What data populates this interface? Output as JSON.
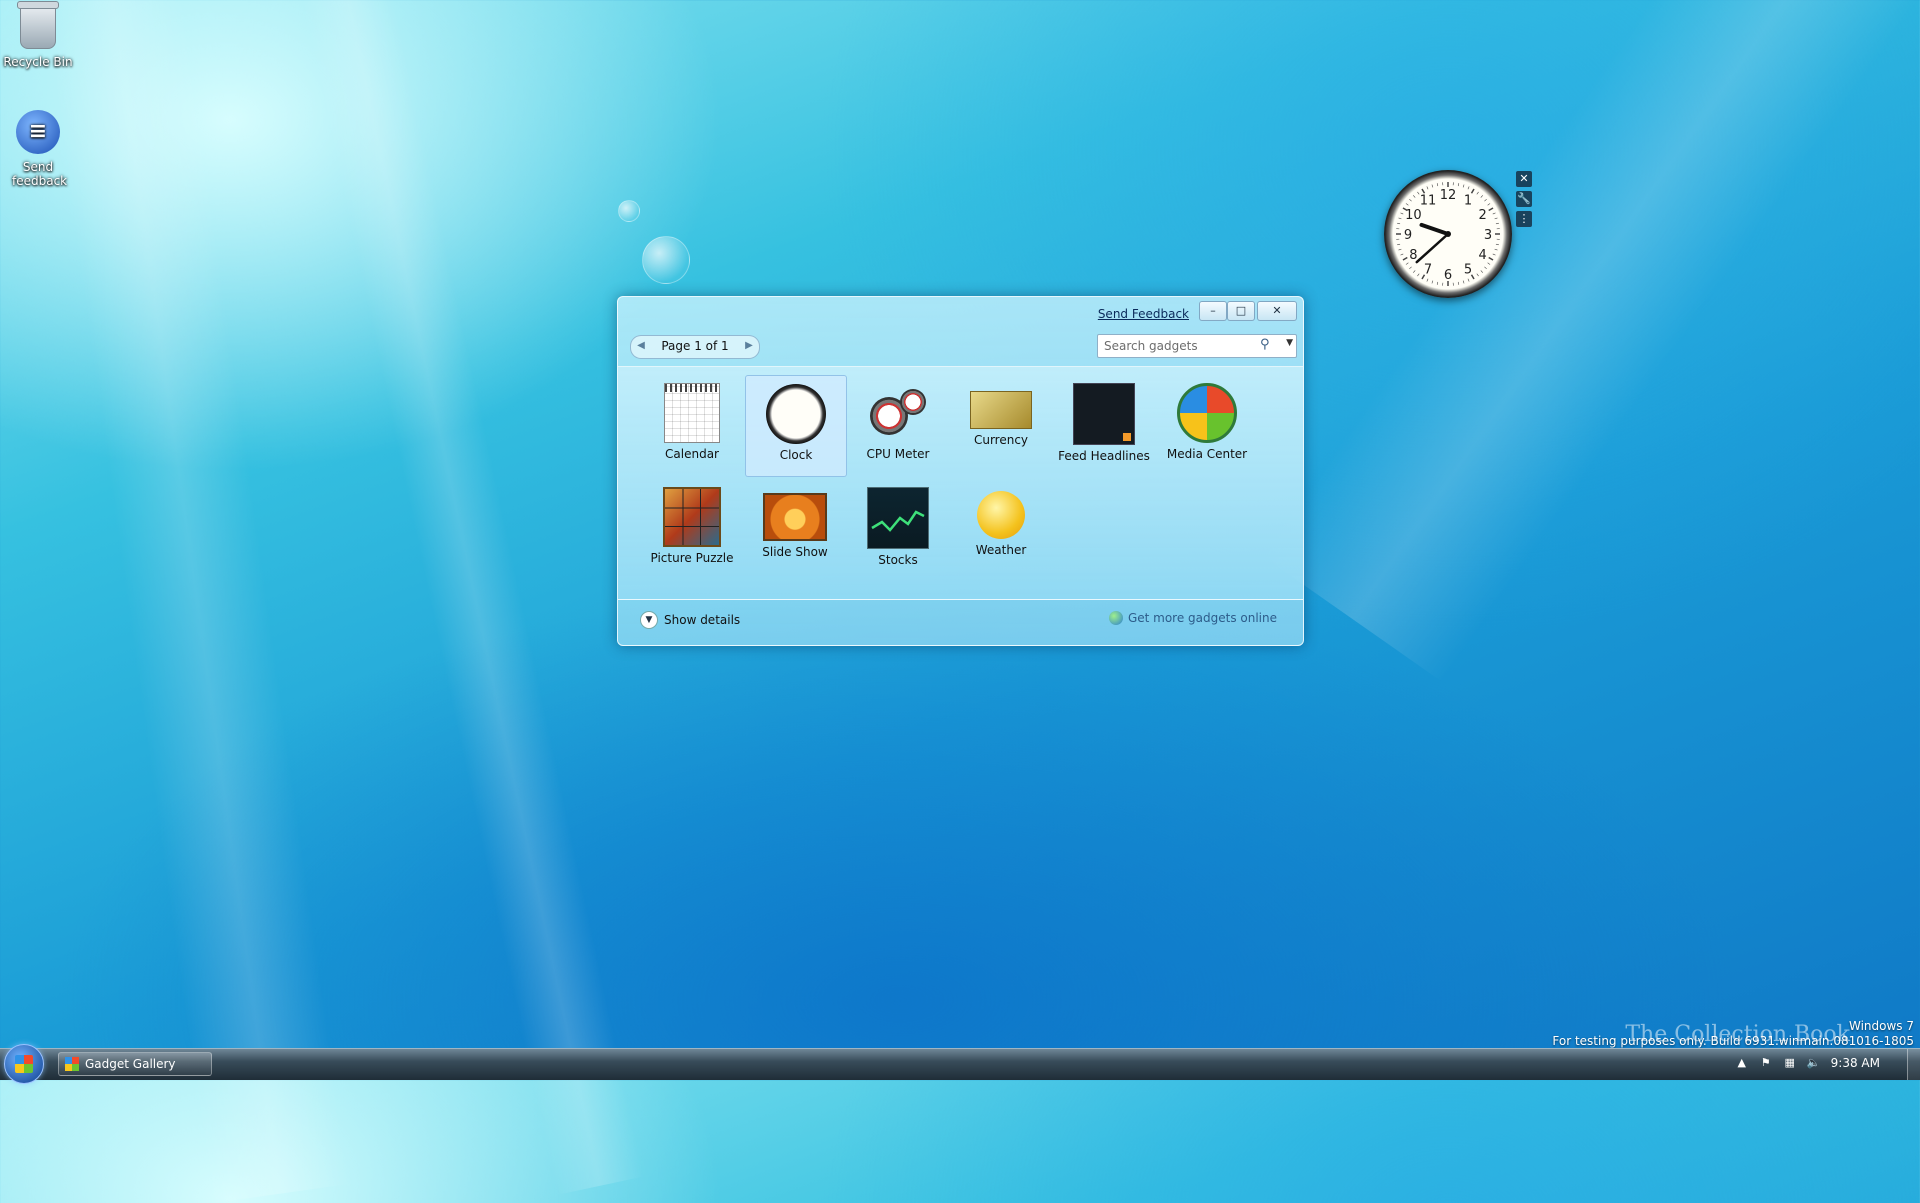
{
  "desktop": {
    "icons": [
      {
        "label": "Recycle Bin",
        "icon": "recycle-bin-icon"
      },
      {
        "label": "Send feedback",
        "icon": "send-feedback-icon"
      }
    ]
  },
  "clock_gadget": {
    "numbers": [
      "12",
      "1",
      "2",
      "3",
      "4",
      "5",
      "6",
      "7",
      "8",
      "9",
      "10",
      "11"
    ],
    "time_hour": 9,
    "time_minute": 38
  },
  "gallery": {
    "send_feedback": "Send Feedback",
    "pager": "Page 1 of 1",
    "search_placeholder": "Search gadgets",
    "gadgets": [
      {
        "label": "Calendar",
        "selected": false
      },
      {
        "label": "Clock",
        "selected": true
      },
      {
        "label": "CPU Meter",
        "selected": false
      },
      {
        "label": "Currency",
        "selected": false
      },
      {
        "label": "Feed Headlines",
        "selected": false
      },
      {
        "label": "Media Center",
        "selected": false
      },
      {
        "label": "Picture Puzzle",
        "selected": false
      },
      {
        "label": "Slide Show",
        "selected": false
      },
      {
        "label": "Stocks",
        "selected": false
      },
      {
        "label": "Weather",
        "selected": false
      }
    ],
    "show_details": "Show details",
    "get_more": "Get more gadgets online"
  },
  "taskbar": {
    "active_window": "Gadget Gallery",
    "time": "9:38 AM"
  },
  "watermark": {
    "line1": "Windows 7",
    "line2": "For testing purposes only. Build 6931.winmain.081016-1805",
    "overlay": "The Collection Book"
  },
  "colors": {
    "desktop_accent": "#1a9bd6",
    "taskbar": "#2b3b47"
  }
}
